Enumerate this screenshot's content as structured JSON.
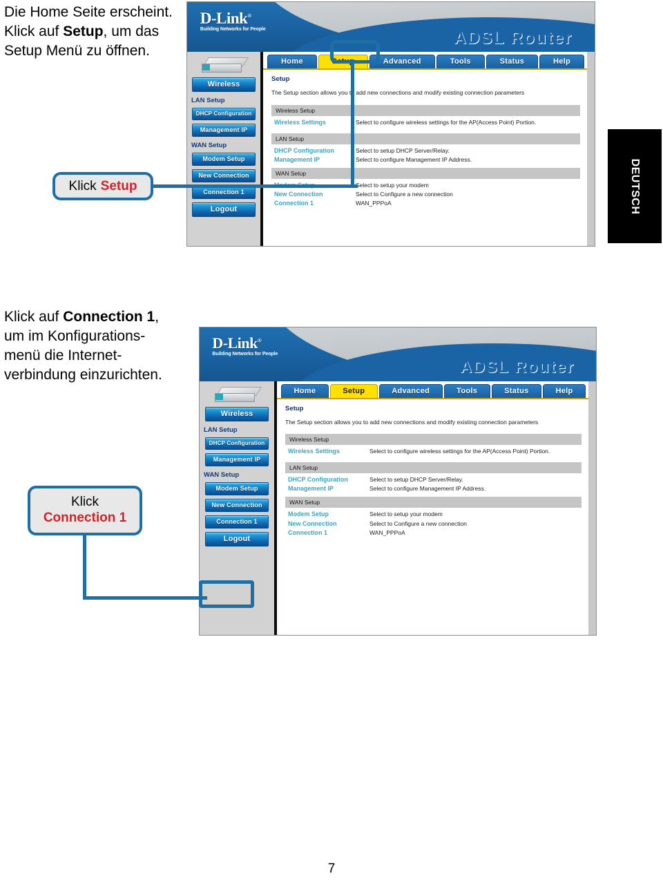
{
  "page": {
    "number": "7",
    "language_tab": "DEUTSCH"
  },
  "steps": [
    {
      "id": "step-setup",
      "text_lead": "Die Home Seite erscheint. Klick auf ",
      "text_bold": "Setup",
      "text_tail": ", um das Setup Menü zu öffnen.",
      "callout_prefix": "Klick",
      "callout_keyword": "Setup"
    },
    {
      "id": "step-connection1",
      "text_lead": "Klick auf ",
      "text_bold": "Connection 1",
      "text_tail": ", um im Konfigurations-menü  die Internet-verbindung einzurichten.",
      "callout_prefix": "Klick",
      "callout_keyword": "Connection 1"
    }
  ],
  "router_ui": {
    "brand": "D-Link",
    "brand_registered": "®",
    "brand_tagline": "Building Networks for People",
    "product_name": "ADSL Router",
    "device_icon": "router-device-icon",
    "nav_tabs": [
      {
        "label": "Home",
        "active": false
      },
      {
        "label": "Setup",
        "active": true
      },
      {
        "label": "Advanced",
        "active": false
      },
      {
        "label": "Tools",
        "active": false
      },
      {
        "label": "Status",
        "active": false
      },
      {
        "label": "Help",
        "active": false
      }
    ],
    "sidebar": [
      {
        "type": "button",
        "label": "Wireless",
        "size": "big"
      },
      {
        "type": "label",
        "label": "LAN Setup"
      },
      {
        "type": "button",
        "label": "DHCP Configuration",
        "size": "wide"
      },
      {
        "type": "button",
        "label": "Management IP",
        "size": "normal"
      },
      {
        "type": "label",
        "label": "WAN Setup"
      },
      {
        "type": "button",
        "label": "Modem Setup",
        "size": "normal"
      },
      {
        "type": "button",
        "label": "New Connection",
        "size": "normal"
      },
      {
        "type": "button",
        "label": "Connection 1",
        "size": "normal"
      },
      {
        "type": "button",
        "label": "Logout",
        "size": "big"
      }
    ],
    "panel": {
      "heading": "Setup",
      "description": "The Setup section allows you to add new connections and modify existing connection parameters",
      "sections": [
        {
          "title": "Wireless Setup",
          "rows": [
            {
              "link": "Wireless Settings",
              "desc": "Select to configure wireless settings for the AP(Access Point) Portion."
            }
          ]
        },
        {
          "title": "LAN Setup",
          "rows": [
            {
              "link": "DHCP Configuration",
              "desc": "Select to setup DHCP Server/Relay."
            },
            {
              "link": "Management IP",
              "desc": "Select to configure Management IP Address."
            }
          ]
        },
        {
          "title": "WAN Setup",
          "rows": [
            {
              "link": "Modem Setup",
              "desc": "Select to setup your modem"
            },
            {
              "link": "New Connection",
              "desc": "Select to Configure a new connection"
            },
            {
              "link": "Connection 1",
              "desc": "WAN_PPPoA"
            }
          ]
        }
      ]
    }
  },
  "colors": {
    "callout_border": "#1d6fa5",
    "keyword_red": "#d2232a",
    "tab_active_yellow": "#ffe000",
    "banner_blue": "#1a63a4",
    "link_cyan": "#3ba6c7"
  }
}
